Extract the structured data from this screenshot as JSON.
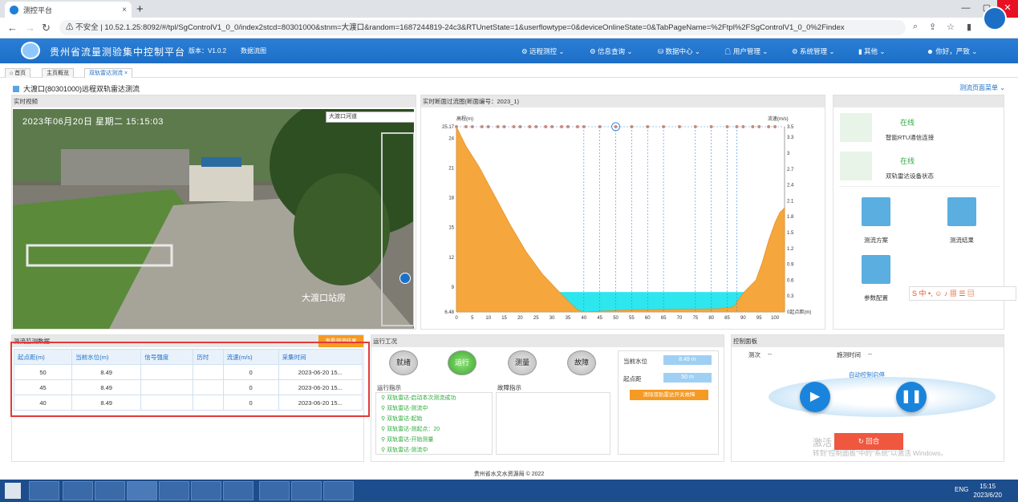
{
  "browser": {
    "tab_title": "测控平台",
    "tab_close": "×",
    "new_tab": "+",
    "insecure_label": "不安全",
    "url": "10.52.1.25:8092/#/tpl/SgControlV1_0_0/index2stcd=80301000&stnm=大渡口&random=1687244819-24c3&RTUnetState=1&userflowtype=0&deviceOnlineState=0&TabPageName=%2Ftpl%2FSgControlV1_0_0%2Findex"
  },
  "header": {
    "title": "贵州省流量测验集中控制平台",
    "version": "版本：V1.0.2",
    "flow_chart": "数据流图",
    "menus": [
      "远程测控",
      "信息查询",
      "数据中心",
      "用户管理",
      "系统管理",
      "其他"
    ],
    "greeting": "你好，严致"
  },
  "page_tabs": [
    "首页",
    "主页概览",
    "双轨雷达测流"
  ],
  "station_title": "大渡口(80301000)远程双轨雷达测流",
  "switch_page": "测流页面菜单",
  "video": {
    "panel_title": "实时视频",
    "channel": "大渡口河道",
    "timestamp": "2023年06月20日 星期二 15:15:03",
    "overlay_label": "大渡口站房"
  },
  "section_chart": {
    "panel_title": "实时断面过流图(断面编号：2023_1)",
    "left_axis_label": "高程(m)",
    "right_axis_label": "流速(m/s)",
    "bottom_right_label": "起点距(m)"
  },
  "chart_data": {
    "type": "area",
    "title": "实时断面过流图(断面编号：2023_1)",
    "xlabel": "起点距(m)",
    "ylabel": "高程(m)",
    "y2label": "流速(m/s)",
    "xlim": [
      0,
      103
    ],
    "ylim": [
      6.48,
      25.17
    ],
    "y2lim": [
      0,
      3.5
    ],
    "x_ticks": [
      0,
      5,
      10,
      15,
      20,
      25,
      30,
      35,
      40,
      45,
      50,
      55,
      60,
      65,
      70,
      75,
      80,
      85,
      90,
      95,
      100
    ],
    "y_ticks": [
      "6.48",
      "9",
      "12",
      "15",
      "18",
      "21",
      "24",
      "25.17"
    ],
    "y2_ticks": [
      "0起点距(m)",
      "0.3",
      "0.6",
      "0.9",
      "1.2",
      "1.5",
      "1.8",
      "2.1",
      "2.4",
      "2.7",
      "3",
      "3.3",
      "3.5"
    ],
    "riverbed_profile": [
      [
        0,
        25.17
      ],
      [
        3,
        23.2
      ],
      [
        7,
        21.2
      ],
      [
        12,
        18.2
      ],
      [
        17,
        15.2
      ],
      [
        22,
        12.5
      ],
      [
        27,
        10.3
      ],
      [
        32,
        8.6
      ],
      [
        36,
        7.3
      ],
      [
        38,
        6.7
      ],
      [
        40,
        6.48
      ],
      [
        45,
        6.55
      ],
      [
        55,
        6.7
      ],
      [
        70,
        6.75
      ],
      [
        82,
        6.8
      ],
      [
        87,
        7.0
      ],
      [
        90,
        8.4
      ],
      [
        94,
        9.7
      ],
      [
        96,
        11.5
      ],
      [
        98,
        13.7
      ],
      [
        100,
        15.5
      ],
      [
        101.5,
        16.5
      ],
      [
        103,
        17.0
      ]
    ],
    "water_level": 8.49,
    "water_span": [
      32,
      91
    ],
    "velocity_points_x": [
      0,
      3,
      5,
      8,
      10,
      13,
      15,
      18,
      20,
      23,
      25,
      28,
      30,
      33,
      35,
      38,
      40,
      45,
      50,
      55,
      60,
      65,
      70,
      75,
      80,
      85,
      88,
      90,
      93,
      95,
      98,
      100
    ],
    "velocity_at_top": 3.5,
    "highlight_x": 50,
    "vertical_lines_x": [
      40,
      45,
      50,
      55,
      60,
      65,
      75,
      80,
      85,
      88
    ]
  },
  "status_panel": {
    "items": [
      {
        "state": "在线",
        "label": "智能RTU通信连接"
      },
      {
        "state": "在线",
        "label": "双轨雷达设备状态"
      }
    ],
    "actions": [
      "测流方案",
      "测流结果",
      "参数配置"
    ]
  },
  "measure_panel": {
    "panel_title": "测流监测数据",
    "export_button": "查看测流结果",
    "columns": [
      "起点距(m)",
      "当前水位(m)",
      "信号强度",
      "历时",
      "流速(m/s)",
      "采集时间"
    ],
    "rows": [
      [
        "50",
        "8.49",
        "",
        "",
        "0",
        "2023-06-20 15..."
      ],
      [
        "45",
        "8.49",
        "",
        "",
        "0",
        "2023-06-20 15..."
      ],
      [
        "40",
        "8.49",
        "",
        "",
        "0",
        "2023-06-20 15..."
      ]
    ]
  },
  "run_panel": {
    "panel_title": "运行工况",
    "states": [
      "就绪",
      "运行",
      "测量",
      "故障"
    ],
    "active_state": "运行",
    "run_hint_title": "运行指示",
    "fault_hint_title": "故障指示",
    "run_logs": [
      "双轨雷达-启动本次测流成功",
      "双轨雷达-测流中",
      "双轨雷达-起始",
      "双轨雷达-测起点：20",
      "双轨雷达-开始测量",
      "双轨雷达-测流中"
    ],
    "water_level_label": "当前水位",
    "water_level_value": "8.49 m",
    "start_dist_label": "起点距",
    "start_dist_value": "50 m",
    "clear_button": "清除双轨雷达开关故障"
  },
  "control_panel": {
    "panel_title": "控制面板",
    "count_label": "测次",
    "count_value": "--",
    "time_label": "施测时间",
    "time_value": "--",
    "auto_link": "自动控制启停",
    "return_button": "回合",
    "watermark_1": "激活 Windows",
    "watermark_2": "转到\"控制面板\"中的\"系统\"以激活 Windows。"
  },
  "footer": "贵州省水文水资源局 © 2022",
  "taskbar": {
    "time": "15:15",
    "date": "2023/6/20",
    "lang": "ENG"
  },
  "colors": {
    "accent": "#1d6fc6",
    "header": "#2a7ed6",
    "terrain": "#f5a63c",
    "water": "#2ee6ee",
    "online": "#2eaa3c",
    "alert": "#e23a3a"
  }
}
